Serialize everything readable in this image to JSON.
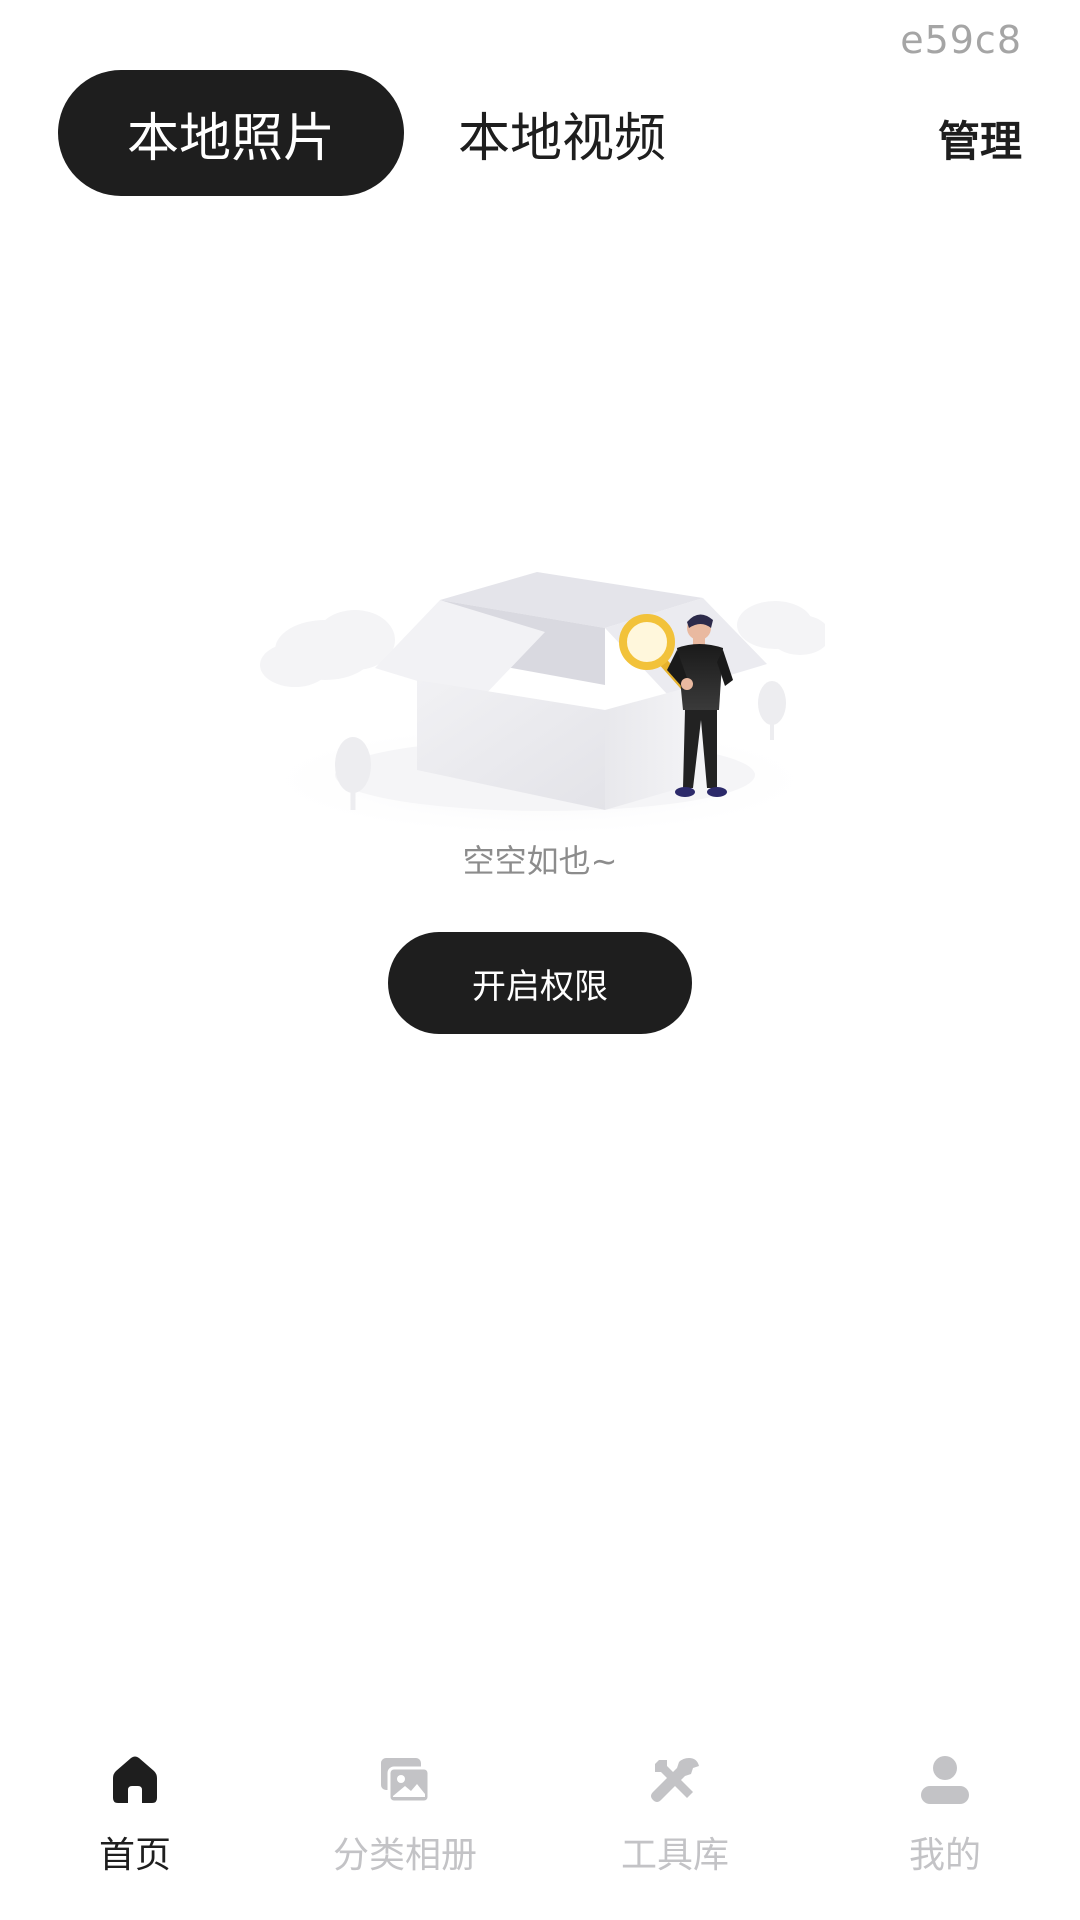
{
  "status": {
    "corner_id": "e59c8"
  },
  "header": {
    "tabs": [
      {
        "label": "本地照片",
        "active": true
      },
      {
        "label": "本地视频",
        "active": false
      }
    ],
    "manage_label": "管理"
  },
  "empty_state": {
    "illustration_icon": "empty-box-with-person-magnifier",
    "message": "空空如也~",
    "button_label": "开启权限"
  },
  "bottom_nav": {
    "items": [
      {
        "label": "首页",
        "icon": "home-icon",
        "active": true
      },
      {
        "label": "分类相册",
        "icon": "album-icon",
        "active": false
      },
      {
        "label": "工具库",
        "icon": "tools-icon",
        "active": false
      },
      {
        "label": "我的",
        "icon": "profile-icon",
        "active": false
      }
    ]
  },
  "colors": {
    "primary": "#1e1e1e",
    "inactive": "#c3c3c6",
    "muted_text": "#8c8c8c",
    "accent_yellow": "#f2c23a"
  }
}
